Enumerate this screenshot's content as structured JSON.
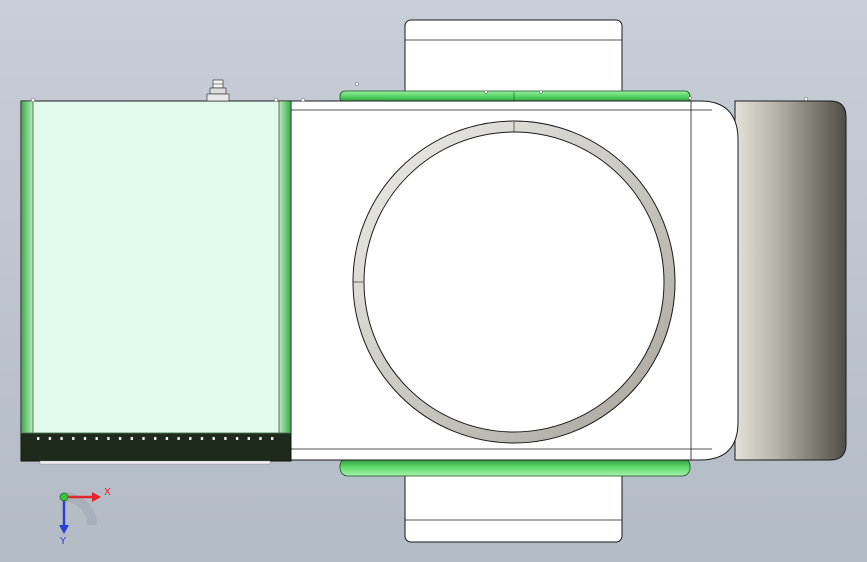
{
  "viewport": {
    "background_top": "#c8ced6",
    "background_bottom": "#b3bbc5"
  },
  "model": {
    "colors": {
      "panel_left": "#e2fbec",
      "panel_left_edge": "#9fe8a8",
      "panel_left_edge_dark": "#3e9c4b",
      "connector_strip": "#1e2a1c",
      "housing": "#ffffff",
      "housing_stroke": "#1a1a1a",
      "ring_green": "#5ddb6a",
      "ring_green_dark": "#2d8a3a",
      "cap_dark": "#5a5850",
      "cap_light": "#d8d6cc",
      "ring_shade": "#b8b4ae"
    }
  },
  "triad": {
    "x_label": "X",
    "y_label": "Y",
    "x_color": "#e2262b",
    "y_color": "#2c3fd6",
    "origin_color": "#36c642"
  }
}
